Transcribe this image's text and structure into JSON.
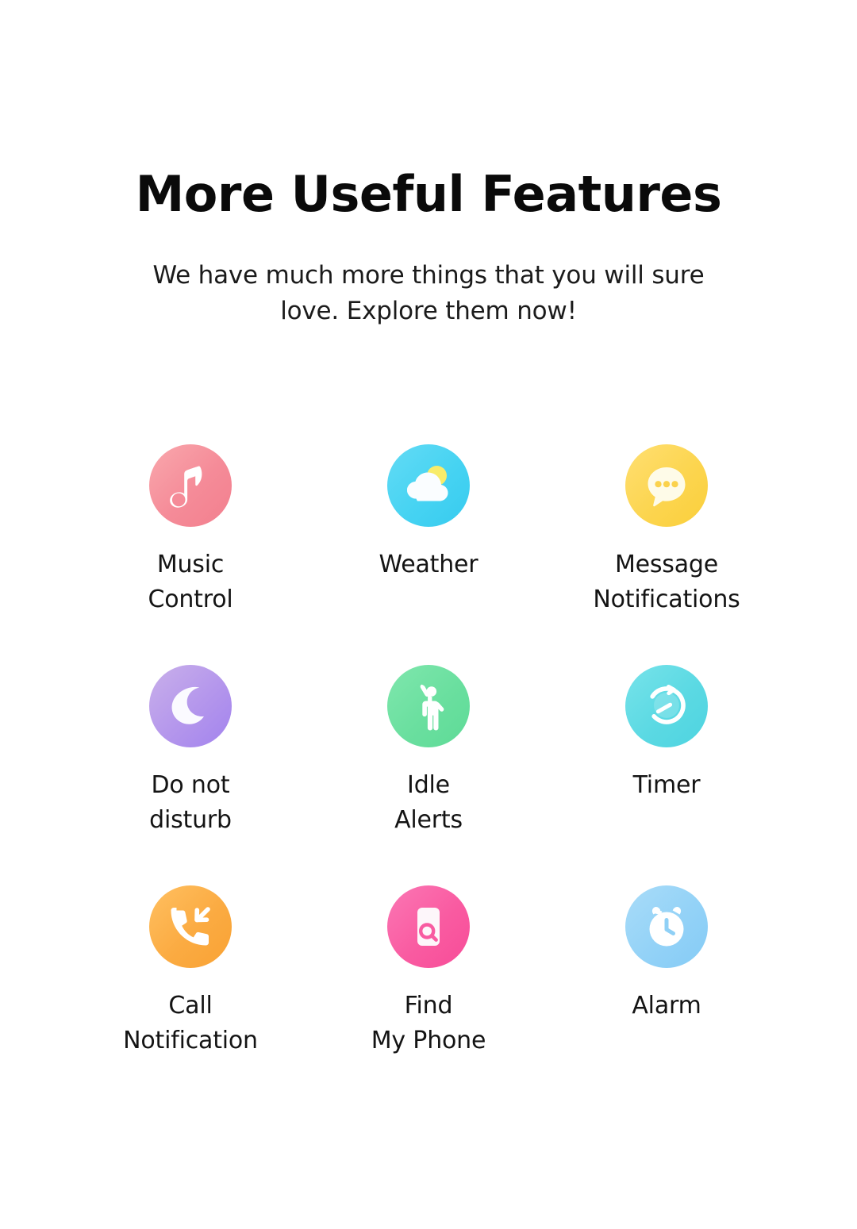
{
  "header": {
    "title": "More Useful Features",
    "subtitle_line_1": "We have much more things that you will sure",
    "subtitle_line_2": "love. Explore them now!"
  },
  "features": [
    {
      "icon": "music-note-icon",
      "label_line_1": "Music",
      "label_line_2": "Control",
      "color": "#f58b98"
    },
    {
      "icon": "cloud-sun-icon",
      "label_line_1": "Weather",
      "label_line_2": "",
      "color": "#46d3f2"
    },
    {
      "icon": "speech-bubble-icon",
      "label_line_1": "Message",
      "label_line_2": "Notifications",
      "color": "#fcd54f"
    },
    {
      "icon": "crescent-moon-icon",
      "label_line_1": "Do not",
      "label_line_2": "disturb",
      "color": "#b496ec"
    },
    {
      "icon": "stretching-person-icon",
      "label_line_1": "Idle",
      "label_line_2": "Alerts",
      "color": "#6adf9f"
    },
    {
      "icon": "stopwatch-icon",
      "label_line_1": "Timer",
      "label_line_2": "",
      "color": "#5bd9e3"
    },
    {
      "icon": "incoming-call-icon",
      "label_line_1": "Call",
      "label_line_2": "Notification",
      "color": "#fbab42"
    },
    {
      "icon": "phone-search-icon",
      "label_line_1": "Find",
      "label_line_2": "My Phone",
      "color": "#f95ba1"
    },
    {
      "icon": "alarm-clock-icon",
      "label_line_1": "Alarm",
      "label_line_2": "",
      "color": "#93d2f7"
    }
  ],
  "theme": {
    "background": "#ffffff",
    "title_color": "#0a0a0a",
    "text_color": "#141414"
  }
}
